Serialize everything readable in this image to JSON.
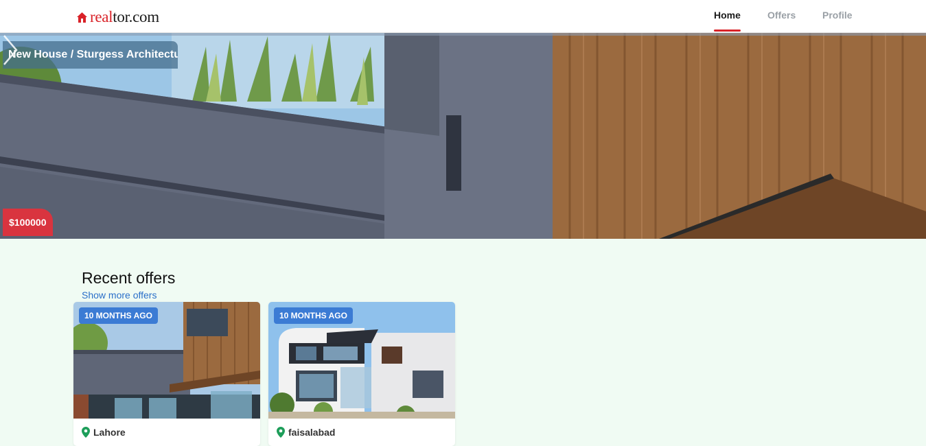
{
  "brand": {
    "name_part1": "real",
    "name_part2": "tor.com",
    "color": "#d92228"
  },
  "nav": {
    "items": [
      {
        "label": "Home",
        "active": true
      },
      {
        "label": "Offers",
        "active": false
      },
      {
        "label": "Profile",
        "active": false
      }
    ]
  },
  "hero": {
    "title": "New House / Sturgess Architectu",
    "price": "$100000",
    "next_icon": "chevron-right-icon"
  },
  "recent": {
    "title": "Recent offers",
    "show_more": "Show more offers",
    "cards": [
      {
        "badge": "10 MONTHS AGO",
        "location": "Lahore",
        "location_icon": "map-pin-icon"
      },
      {
        "badge": "10 MONTHS AGO",
        "location": "faisalabad",
        "location_icon": "map-pin-icon"
      }
    ]
  },
  "colors": {
    "accent_red": "#d92228",
    "badge_blue": "#3b7bd4",
    "link_blue": "#2a6fc9",
    "page_bg": "#f0fbf3",
    "pin_green": "#1e9e5a"
  }
}
